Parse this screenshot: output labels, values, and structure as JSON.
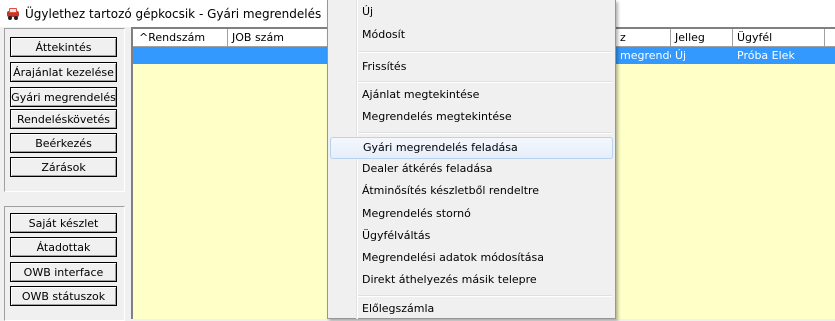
{
  "window": {
    "title": "Ügylethez tartozó gépkocsik - Gyári megrendelés",
    "icon": "car-icon"
  },
  "left_panel": {
    "group1": [
      "Áttekintés",
      "Árajánlat kezelése",
      "Gyári megrendelés",
      "Rendeléskövetés",
      "Beérkezés",
      "Zárások"
    ],
    "group2": [
      "Saját készlet",
      "Átadottak",
      "OWB interface",
      "OWB státuszok"
    ]
  },
  "grid": {
    "columns_left": [
      "^Rendszám",
      "JOB szám"
    ],
    "columns_right": [
      "z",
      "Jelleg",
      "Ügyfél"
    ],
    "selected_row": {
      "col_z": "megrendé...",
      "jelleg": "Új",
      "ugyfel": "Próba Elek"
    },
    "background": "#ffffc8",
    "selection_color": "#3399ff"
  },
  "context_menu": {
    "items": [
      "Új",
      "Módosít",
      "Frissítés",
      "Ajánlat megtekintése",
      "Megrendelés megtekintése",
      "Gyári megrendelés feladása",
      "Dealer átkérés feladása",
      "Átminősítés készletből rendeltre",
      "Megrendelés stornó",
      "Ügyfélváltás",
      "Megrendelési adatok módosítása",
      "Direkt áthelyezés másik telepre",
      "Előlegszámla"
    ],
    "highlighted": "Gyári megrendelés feladása"
  }
}
